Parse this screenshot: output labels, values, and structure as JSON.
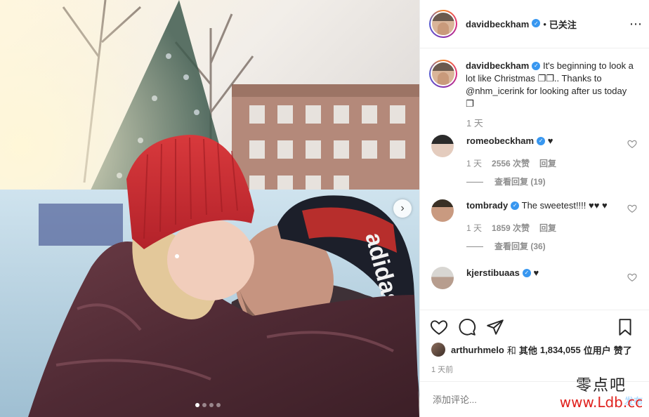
{
  "media": {
    "next_icon": "chevron-right-icon",
    "slide_count": 4,
    "active_slide": 1
  },
  "header": {
    "username": "davidbeckham",
    "separator": "•",
    "follow_status": "已关注",
    "more_icon": "⋯"
  },
  "caption": {
    "username": "davidbeckham",
    "text": "It's beginning to look a lot like Christmas ❐❐.. Thanks to @nhm_icerink for looking after us today ❐",
    "time": "1 天"
  },
  "comments": [
    {
      "username": "romeobeckham",
      "text": "♥",
      "time": "1 天",
      "likes": "2556 次赞",
      "reply": "回复",
      "view_replies": "查看回复 (19)"
    },
    {
      "username": "tombrady",
      "text": "The sweetest!!!! ♥♥ ♥",
      "time": "1 天",
      "likes": "1859 次赞",
      "reply": "回复",
      "view_replies": "查看回复 (36)"
    },
    {
      "username": "kjerstibuaas",
      "text": "♥"
    }
  ],
  "likes": {
    "user": "arthurhmelo",
    "and": "和",
    "others_label": "其他",
    "count": "1,834,055",
    "users_label": "位用户",
    "liked": "赞了"
  },
  "time_ago": "1 天前",
  "add_comment": {
    "placeholder": "添加评论...",
    "post_label": "发布"
  },
  "watermark": {
    "line1": "零点吧",
    "line2": "www.Ldb.cc"
  },
  "colors": {
    "verified": "#3897f0",
    "text": "#262626",
    "muted": "#8e8e8e",
    "post_disabled": "#b3dbff",
    "watermark_red": "#e0221e"
  }
}
